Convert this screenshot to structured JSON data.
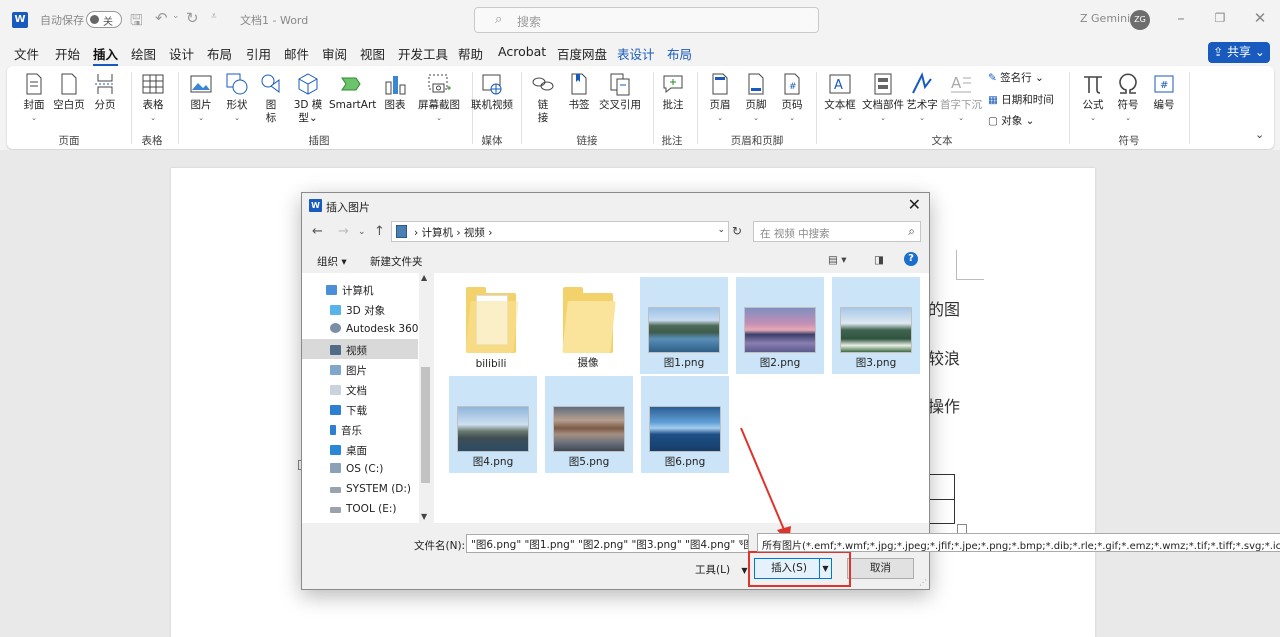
{
  "titlebar": {
    "autosave_label": "自动保存",
    "autosave_state": "关",
    "doc_title": "文档1 - Word",
    "search_placeholder": "搜索",
    "user_name": "Z Gemini",
    "user_initials": "ZG"
  },
  "tabs": [
    "文件",
    "开始",
    "插入",
    "绘图",
    "设计",
    "布局",
    "引用",
    "邮件",
    "审阅",
    "视图",
    "开发工具",
    "帮助",
    "Acrobat",
    "百度网盘",
    "表设计",
    "布局"
  ],
  "active_tab": "插入",
  "share_label": "共享",
  "ribbon": {
    "cover": "封面",
    "blank_page": "空白页",
    "page_break": "分页",
    "group_pages": "页面",
    "table": "表格",
    "group_tables": "表格",
    "pictures": "图片",
    "shapes": "形状",
    "icons_1": "图",
    "icons_2": "标",
    "model3d_1": "3D 模",
    "model3d_2": "型",
    "smartart": "SmartArt",
    "chart": "图表",
    "screenshot": "屏幕截图",
    "group_illustrations": "插图",
    "online_video": "联机视频",
    "group_media": "媒体",
    "link_1": "链",
    "link_2": "接",
    "bookmark": "书签",
    "cross_ref": "交叉引用",
    "group_links": "链接",
    "comment": "批注",
    "group_comments": "批注",
    "header": "页眉",
    "footer": "页脚",
    "page_number": "页码",
    "group_header_footer": "页眉和页脚",
    "textbox": "文本框",
    "quick_parts": "文档部件",
    "wordart": "艺术字",
    "dropcap": "首字下沉",
    "signature_line": "签名行",
    "datetime": "日期和时间",
    "object": "对象",
    "group_text": "文本",
    "equation": "公式",
    "symbol": "符号",
    "number": "编号",
    "group_symbols": "符号"
  },
  "document": {
    "frag1": "的图",
    "frag2": "较浪",
    "frag3": "操作"
  },
  "dialog": {
    "title": "插入图片",
    "breadcrumb": "› 计算机 › 视频 ›",
    "search_placeholder": "在 视频 中搜索",
    "organize": "组织 ▾",
    "new_folder": "新建文件夹",
    "nav": [
      "计算机",
      "3D 对象",
      "Autodesk 360",
      "视频",
      "图片",
      "文档",
      "下载",
      "音乐",
      "桌面",
      "OS (C:)",
      "SYSTEM (D:)",
      "TOOL (E:)"
    ],
    "files": [
      "bilibili",
      "摄像",
      "图1.png",
      "图2.png",
      "图3.png",
      "图4.png",
      "图5.png",
      "图6.png"
    ],
    "filename_label": "文件名(N):",
    "filename_value": "\"图6.png\" \"图1.png\" \"图2.png\" \"图3.png\" \"图4.png\" \"图",
    "filetype_value": "所有图片(*.emf;*.wmf;*.jpg;*.jpeg;*.jfif;*.jpe;*.png;*.bmp;*.dib;*.rle;*.gif;*.emz;*.wmz;*.tif;*.tiff;*.svg;*.ico;*.we",
    "tools_label": "工具(L)",
    "insert_label": "插入(S)",
    "cancel_label": "取消"
  },
  "colors": {
    "accent": "#185abd",
    "selection": "#cce4f7",
    "highlight_annotation": "#e0332e"
  }
}
